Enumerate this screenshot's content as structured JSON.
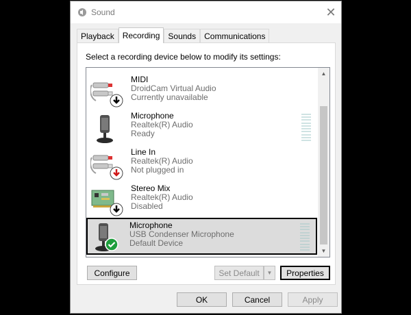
{
  "window": {
    "title": "Sound",
    "close_glyph": "✕"
  },
  "tabs": [
    {
      "label": "Playback",
      "active": false
    },
    {
      "label": "Recording",
      "active": true
    },
    {
      "label": "Sounds",
      "active": false
    },
    {
      "label": "Communications",
      "active": false
    }
  ],
  "instruction": "Select a recording device below to modify its settings:",
  "devices": [
    {
      "name": "MIDI",
      "driver": "DroidCam Virtual Audio",
      "status": "Currently unavailable",
      "icon": "line-in-jack-icon",
      "badge": "black-down-arrow"
    },
    {
      "name": "Microphone",
      "driver": "Realtek(R) Audio",
      "status": "Ready",
      "icon": "microphone-icon",
      "badge": "none"
    },
    {
      "name": "Line In",
      "driver": "Realtek(R) Audio",
      "status": "Not plugged in",
      "icon": "line-in-jack-icon",
      "badge": "red-down-arrow"
    },
    {
      "name": "Stereo Mix",
      "driver": "Realtek(R) Audio",
      "status": "Disabled",
      "icon": "sound-card-icon",
      "badge": "black-down-arrow"
    },
    {
      "name": "Microphone",
      "driver": "USB Condenser Microphone",
      "status": "Default Device",
      "icon": "microphone-icon",
      "badge": "green-check",
      "selected": true
    }
  ],
  "buttons": {
    "configure": "Configure",
    "set_default": "Set Default",
    "properties": "Properties",
    "ok": "OK",
    "cancel": "Cancel",
    "apply": "Apply"
  },
  "colors": {
    "selected_bg": "#dcdcdc",
    "meter": "#cfe3e3",
    "check": "#1e9e3c",
    "not_plugged": "#d01818"
  }
}
